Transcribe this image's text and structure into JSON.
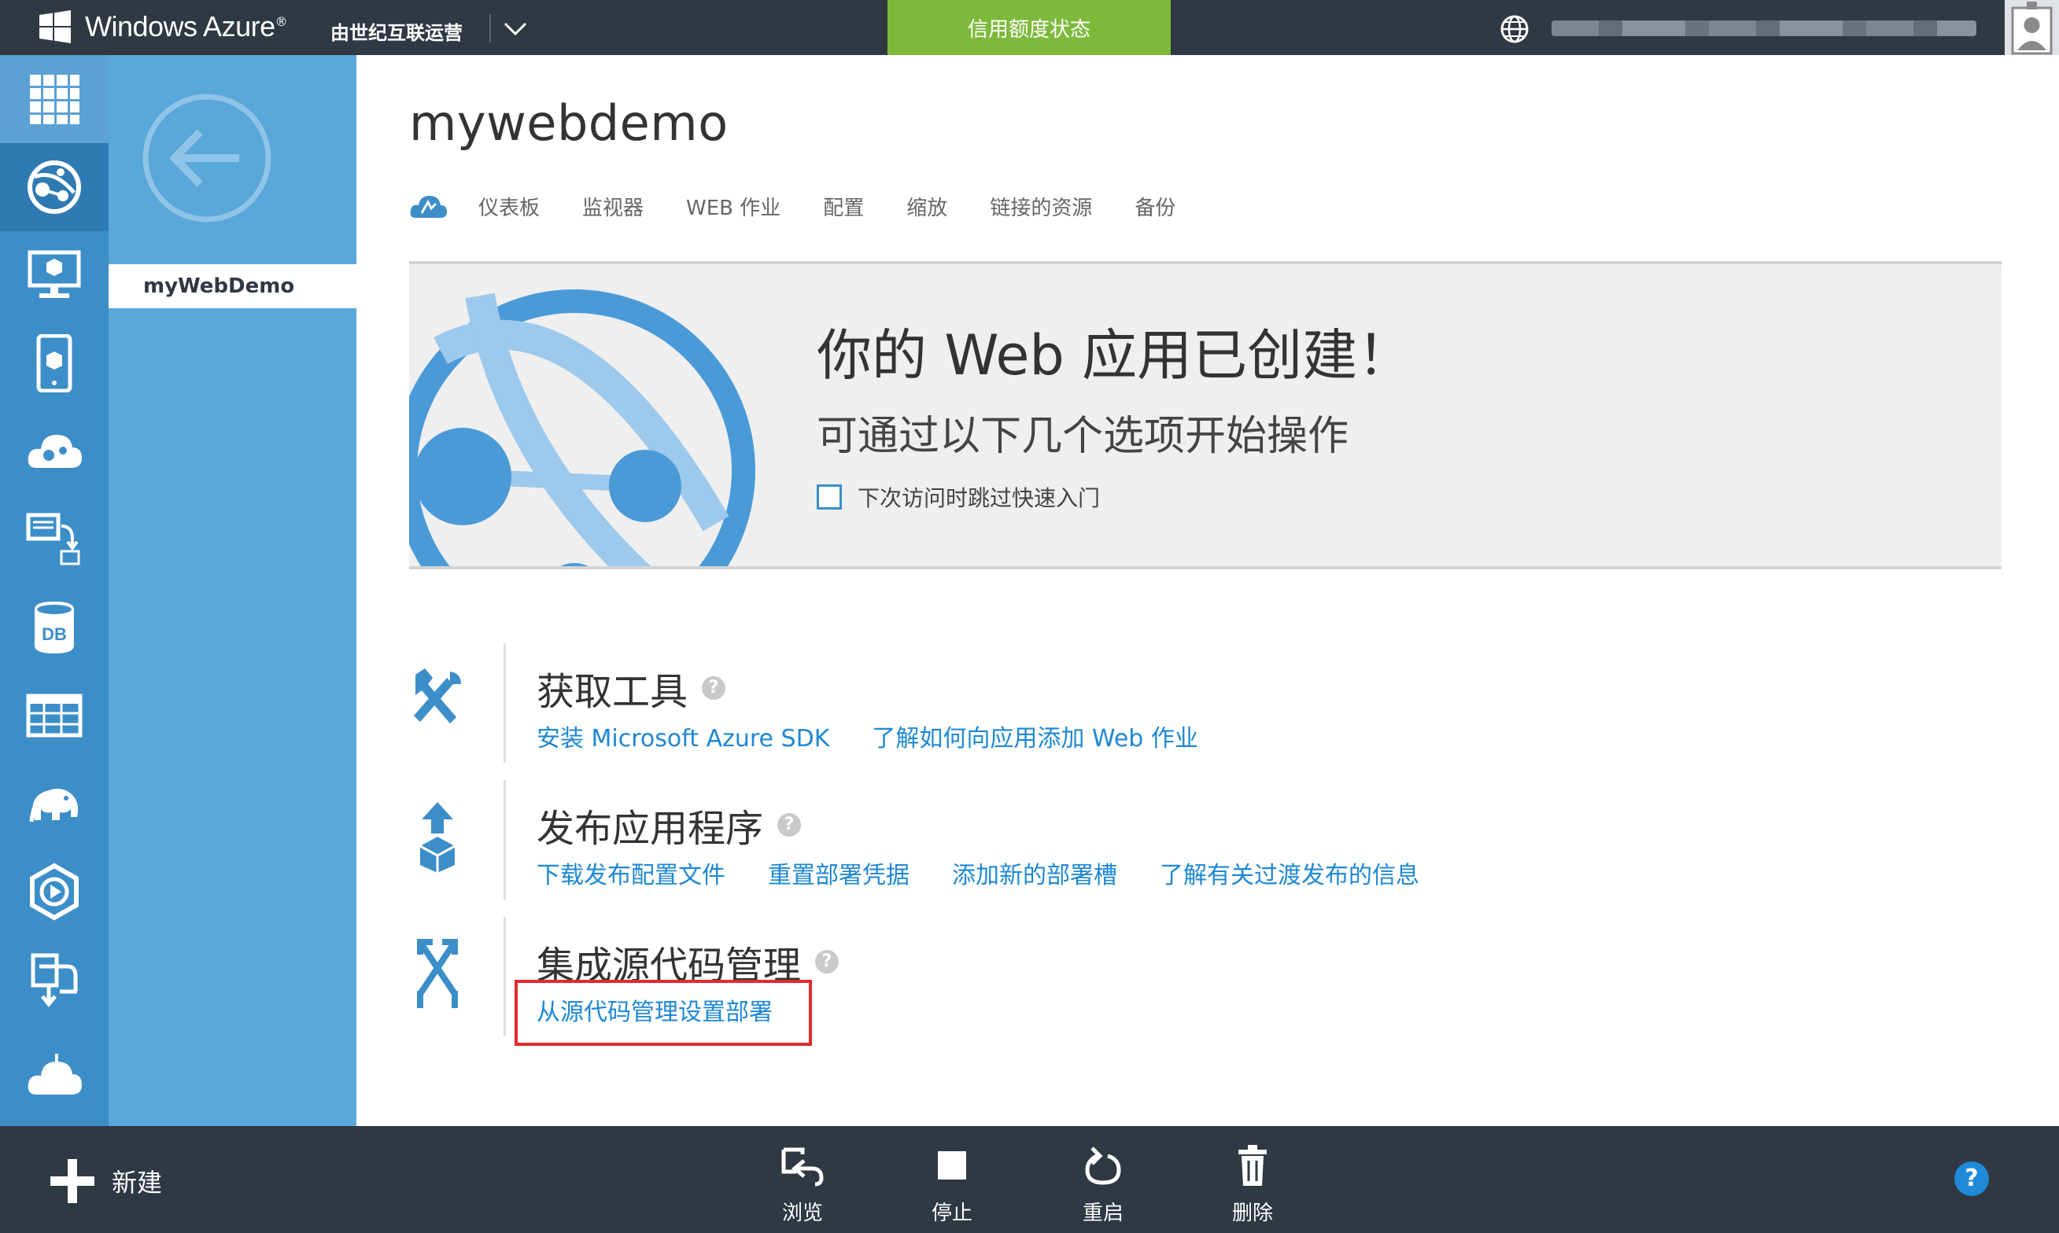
{
  "topbar": {
    "logo_text": "Windows Azure",
    "operator": "由世纪互联运营",
    "credit_status": "信用额度状态"
  },
  "leftnav": {
    "items": [
      {
        "icon": "all-items-grid-icon"
      },
      {
        "icon": "web-apps-icon",
        "active": true
      },
      {
        "icon": "virtual-machines-icon"
      },
      {
        "icon": "mobile-services-icon"
      },
      {
        "icon": "cloud-services-icon"
      },
      {
        "icon": "batch-jobs-icon"
      },
      {
        "icon": "sql-database-icon"
      },
      {
        "icon": "storage-table-icon"
      },
      {
        "icon": "hdinsight-elephant-icon"
      },
      {
        "icon": "media-services-icon"
      },
      {
        "icon": "recovery-services-icon"
      },
      {
        "icon": "cloud-settings-icon"
      }
    ]
  },
  "subnav": {
    "selected_item": "myWebDemo"
  },
  "main": {
    "title": "mywebdemo",
    "tabs": [
      "仪表板",
      "监视器",
      "WEB 作业",
      "配置",
      "缩放",
      "链接的资源",
      "备份"
    ],
    "hero": {
      "title": "你的 Web 应用已创建！",
      "subtitle": "可通过以下几个选项开始操作",
      "skip_checkbox_label": "下次访问时跳过快速入门"
    },
    "sections": [
      {
        "title": "获取工具",
        "icon": "tools-icon",
        "links": [
          "安装 Microsoft Azure SDK",
          "了解如何向应用添加 Web 作业"
        ]
      },
      {
        "title": "发布应用程序",
        "icon": "publish-icon",
        "links": [
          "下载发布配置文件",
          "重置部署凭据",
          "添加新的部署槽",
          "了解有关过渡发布的信息"
        ]
      },
      {
        "title": "集成源代码管理",
        "icon": "source-control-icon",
        "links": [
          "从源代码管理设置部署"
        ]
      }
    ]
  },
  "bottombar": {
    "new_label": "新建",
    "actions": [
      {
        "label": "浏览",
        "icon": "browse-icon"
      },
      {
        "label": "停止",
        "icon": "stop-icon"
      },
      {
        "label": "重启",
        "icon": "restart-icon"
      },
      {
        "label": "删除",
        "icon": "delete-icon"
      }
    ],
    "help": "?"
  },
  "colors": {
    "topbar": "#2f3843",
    "nav_blue": "#3c8ec8",
    "subnav_blue": "#5aa7d9",
    "credit_green": "#7dba3b",
    "link_blue": "#1e88d4",
    "highlight_red": "#e22b2b"
  }
}
